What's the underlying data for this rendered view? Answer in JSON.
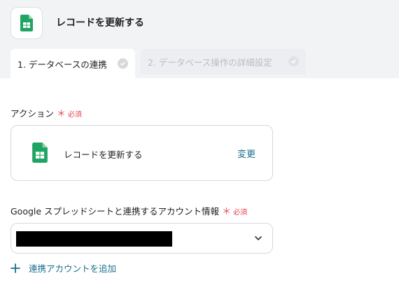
{
  "header": {
    "title": "レコードを更新する",
    "icon": "google-sheets-icon"
  },
  "tabs": [
    {
      "label": "1. データベースの連携",
      "active": true
    },
    {
      "label": "2. データベース操作の詳細設定",
      "active": false
    }
  ],
  "action_section": {
    "label": "アクション",
    "required_mark": "＊",
    "required_text": "必須",
    "card": {
      "label": "レコードを更新する",
      "change_label": "変更",
      "icon": "google-sheets-icon"
    }
  },
  "account_section": {
    "label": "Google スプレッドシートと連携するアカウント情報",
    "required_mark": "＊",
    "required_text": "必須",
    "select_value_redacted": true,
    "add_link_label": "連携アカウントを追加"
  },
  "colors": {
    "accent": "#1a6f8c",
    "required": "#e8434f",
    "sheets_green": "#1fa463"
  }
}
